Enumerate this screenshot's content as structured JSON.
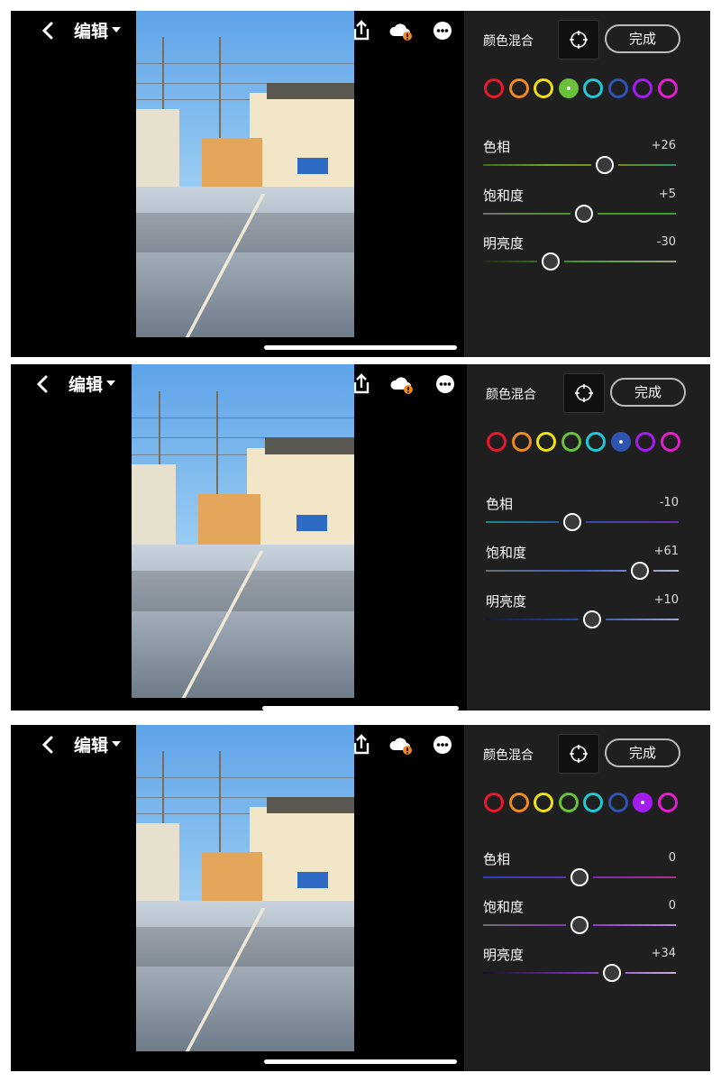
{
  "screens": [
    {
      "header": {
        "title": "编辑"
      },
      "panel": {
        "title": "颜色混合",
        "done_label": "完成"
      },
      "colors": {
        "selected_index": 3
      },
      "sliders": [
        {
          "label": "色相",
          "value": "+26",
          "level": 0.63,
          "track": "linear-gradient(90deg,#3a6f1d,#6fa12f,#7a8a1a,#2e8f6a)"
        },
        {
          "label": "饱和度",
          "value": "+5",
          "level": 0.525,
          "track": "linear-gradient(90deg,#6f6f6f,#4f9a2a,#3aa12b)"
        },
        {
          "label": "明亮度",
          "value": "-30",
          "level": 0.35,
          "track": "linear-gradient(90deg,#1e2c17,#4f9a2a,#9aa58f)"
        }
      ]
    },
    {
      "header": {
        "title": "编辑"
      },
      "panel": {
        "title": "颜色混合",
        "done_label": "完成"
      },
      "colors": {
        "selected_index": 5
      },
      "sliders": [
        {
          "label": "色相",
          "value": "-10",
          "level": 0.45,
          "track": "linear-gradient(90deg,#1b8a8a,#2f4da6,#6a2fb8)"
        },
        {
          "label": "饱和度",
          "value": "+61",
          "level": 0.8,
          "track": "linear-gradient(90deg,#6f6f6f,#3a60c8,#b0b6c5)"
        },
        {
          "label": "明亮度",
          "value": "+10",
          "level": 0.55,
          "track": "linear-gradient(90deg,#121a33,#2b4aa8,#9ea7c4)"
        }
      ]
    },
    {
      "header": {
        "title": "编辑"
      },
      "panel": {
        "title": "颜色混合",
        "done_label": "完成"
      },
      "colors": {
        "selected_index": 6
      },
      "sliders": [
        {
          "label": "色相",
          "value": "0",
          "level": 0.5,
          "track": "linear-gradient(90deg,#2b3fb8,#6a2fb8,#b02f85)"
        },
        {
          "label": "饱和度",
          "value": "0",
          "level": 0.5,
          "track": "linear-gradient(90deg,#6f6f6f,#8a2fc4,#b58ae0)"
        },
        {
          "label": "明亮度",
          "value": "+34",
          "level": 0.67,
          "track": "linear-gradient(90deg,#1a0f22,#7c2fc4,#c7b1d9)"
        }
      ]
    }
  ],
  "color_swatches": [
    "#e8192c",
    "#f08a1e",
    "#f1e312",
    "#6ac13a",
    "#20c9d6",
    "#2d53b3",
    "#a31df0",
    "#e31ecf"
  ],
  "icons": {
    "back": "back-icon",
    "dropdown": "dropdown-arrow-icon",
    "undo": "undo-icon",
    "help": "help-icon",
    "share": "share-icon",
    "cloud_alert": "cloud-warning-icon",
    "more": "more-icon",
    "target": "target-adjust-icon"
  }
}
